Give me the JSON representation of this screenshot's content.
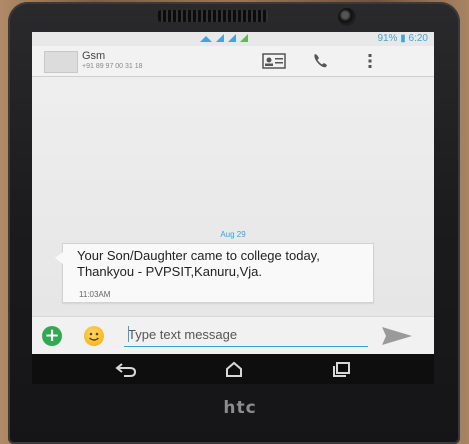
{
  "status_bar": {
    "battery": "91%",
    "time": "6:20"
  },
  "action_bar": {
    "contact_name": "Gsm",
    "contact_number": "+91 89 97 00 31 18",
    "icons": [
      "contact-card-icon",
      "phone-icon",
      "overflow-menu-icon"
    ]
  },
  "conversation": {
    "date_separator": "Aug 29",
    "messages": [
      {
        "text": "Your Son/Daughter came to college today, Thankyou - PVPSIT,Kanuru,Vja.",
        "time": "11:03AM",
        "direction": "incoming"
      }
    ]
  },
  "composer": {
    "placeholder": "Type text message",
    "value": "",
    "icons": [
      "add-attachment-icon",
      "emoji-icon",
      "send-icon"
    ]
  },
  "nav": {
    "icons": [
      "back-icon",
      "home-icon",
      "recent-apps-icon"
    ]
  },
  "device": {
    "brand": "htc"
  },
  "colors": {
    "accent": "#3f9fd6",
    "add_button": "#33a853",
    "bubble": "#f9f9f9"
  }
}
